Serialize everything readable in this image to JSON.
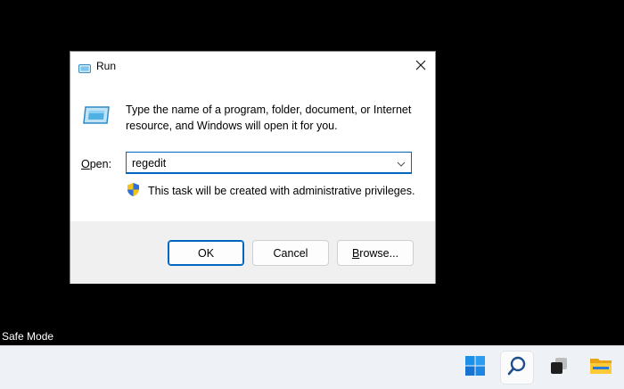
{
  "desktop": {
    "safe_mode_label": "Safe Mode"
  },
  "dialog": {
    "title": "Run",
    "description": "Type the name of a program, folder, document, or Internet resource, and Windows will open it for you.",
    "open_label_prefix": "O",
    "open_label_rest": "pen:",
    "open_value": "regedit",
    "admin_note": "This task will be created with administrative privileges.",
    "buttons": {
      "ok": "OK",
      "cancel": "Cancel",
      "browse_prefix": "B",
      "browse_rest": "rowse..."
    }
  },
  "icons": {
    "title": "run-icon",
    "close": "close-icon",
    "dropdown": "chevron-down-icon",
    "shield": "uac-shield-icon"
  },
  "taskbar": {
    "items": [
      "start-icon",
      "search-icon",
      "task-view-icon",
      "file-explorer-icon"
    ]
  },
  "colors": {
    "accent": "#0067c0",
    "desktop_bg": "#000000",
    "dialog_footer": "#f0f0f0",
    "taskbar_bg": "#eef1f5"
  }
}
